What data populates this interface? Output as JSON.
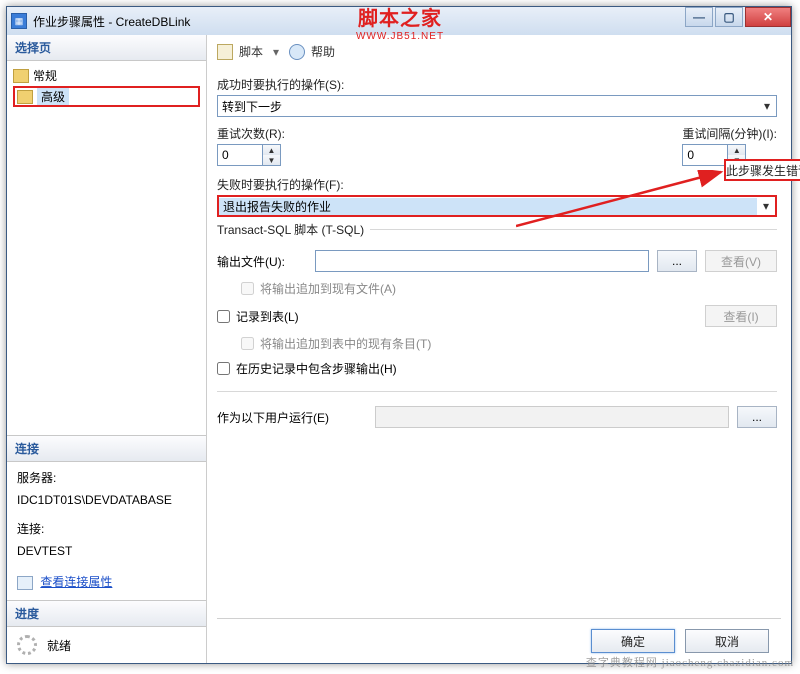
{
  "brand": {
    "name": "脚本之家",
    "url": "WWW.JB51.NET"
  },
  "window": {
    "title": "作业步骤属性 - CreateDBLink"
  },
  "sidebar": {
    "select_page": "选择页",
    "items": [
      {
        "label": "常规"
      },
      {
        "label": "高级"
      }
    ],
    "connection": {
      "header": "连接",
      "server_label": "服务器:",
      "server_value": "IDC1DT01S\\DEVDATABASE",
      "conn_label": "连接:",
      "conn_value": "DEVTEST",
      "view_props": "查看连接属性"
    },
    "progress": {
      "header": "进度",
      "status": "就绪"
    }
  },
  "toolbar": {
    "script": "脚本",
    "help": "帮助"
  },
  "form": {
    "success_label": "成功时要执行的操作(S):",
    "success_value": "转到下一步",
    "retry_label": "重试次数(R):",
    "retry_value": "0",
    "interval_label": "重试间隔(分钟)(I):",
    "interval_value": "0",
    "fail_label": "失败时要执行的操作(F):",
    "fail_value": "退出报告失败的作业",
    "tsql_group": "Transact-SQL 脚本 (T-SQL)",
    "output_label": "输出文件(U):",
    "browse": "...",
    "view_v": "查看(V)",
    "append_file": "将输出追加到现有文件(A)",
    "log_table": "记录到表(L)",
    "view_i": "查看(I)",
    "append_table": "将输出追加到表中的现有条目(T)",
    "include_history": "在历史记录中包含步骤输出(H)",
    "runas_label": "作为以下用户运行(E)"
  },
  "callout": {
    "text": "此步骤发生错误时执行的操作"
  },
  "footer": {
    "ok": "确定",
    "cancel": "取消"
  },
  "watermark": "查字典教程网 jiaocheng.chazidian.com"
}
